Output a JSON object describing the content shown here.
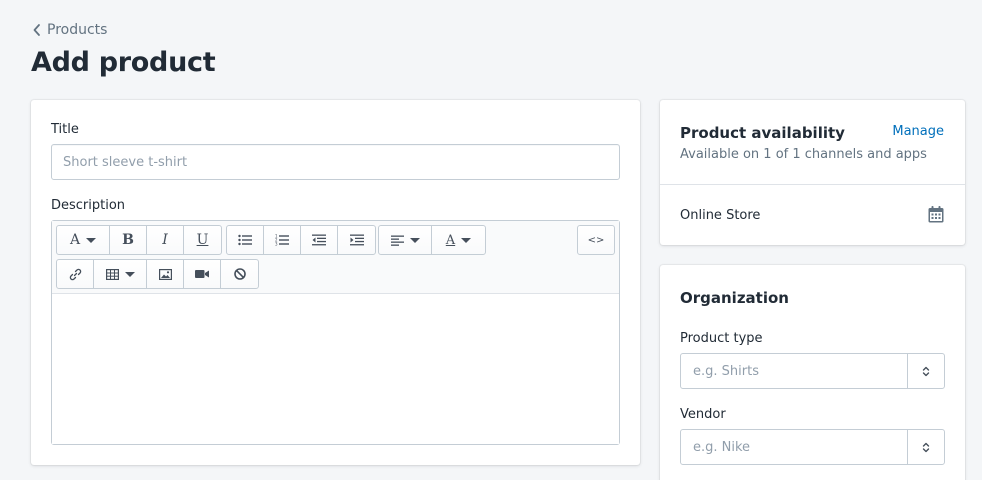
{
  "breadcrumb": {
    "label": "Products"
  },
  "page": {
    "title": "Add product"
  },
  "main": {
    "title_label": "Title",
    "title_placeholder": "Short sleeve t-shirt",
    "description_label": "Description",
    "toolbar": {
      "font_glyph": "A",
      "bold_glyph": "B",
      "italic_glyph": "I",
      "underline_glyph": "U",
      "color_glyph": "A",
      "source_glyph": "<>"
    }
  },
  "availability": {
    "title": "Product availability",
    "manage_label": "Manage",
    "subtitle": "Available on 1 of 1 channels and apps",
    "channel": "Online Store"
  },
  "organization": {
    "title": "Organization",
    "product_type_label": "Product type",
    "product_type_placeholder": "e.g. Shirts",
    "vendor_label": "Vendor",
    "vendor_placeholder": "e.g. Nike"
  },
  "colors": {
    "link": "#006fbb",
    "text": "#212b36",
    "muted": "#637381",
    "border": "#c4cdd5",
    "background": "#f4f6f8"
  }
}
